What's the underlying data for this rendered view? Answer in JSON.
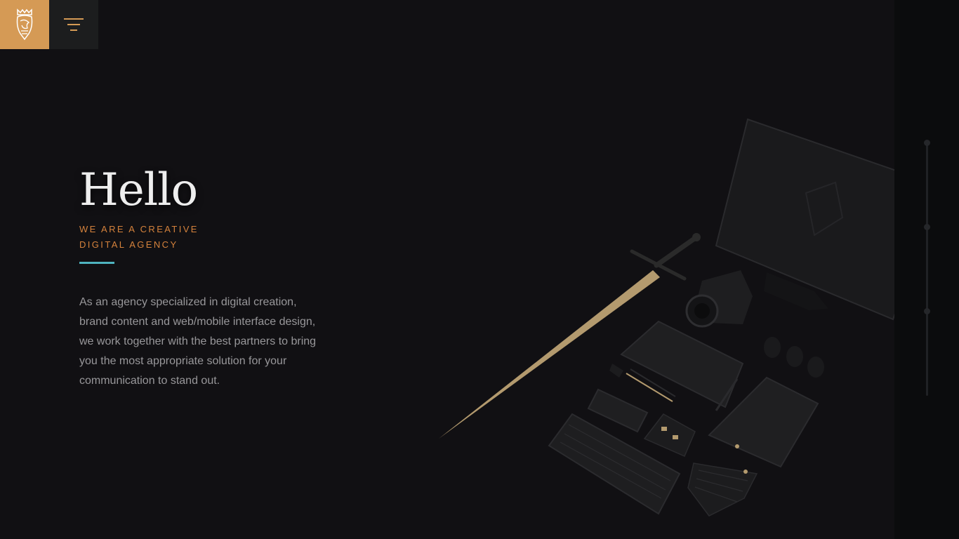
{
  "header": {
    "logo_icon": "lion-crest-icon",
    "menu_icon": "hamburger-menu-icon",
    "brand_color": "#d59a55"
  },
  "hero": {
    "title": "Hello",
    "tagline": "WE ARE A CREATIVE DIGITAL AGENCY",
    "description": "As an agency specialized in digital creation, brand content and web/mobile interface design, we work together with the best partners to bring you the most appropriate solution for your communication to stand out.",
    "accent_color": "#d5823c",
    "underline_color": "#4fb3bf"
  },
  "slide_nav": {
    "dots": [
      1,
      2,
      3
    ],
    "active": 1
  },
  "illustration": {
    "description_icon": "desk-flatlay-illustration"
  }
}
